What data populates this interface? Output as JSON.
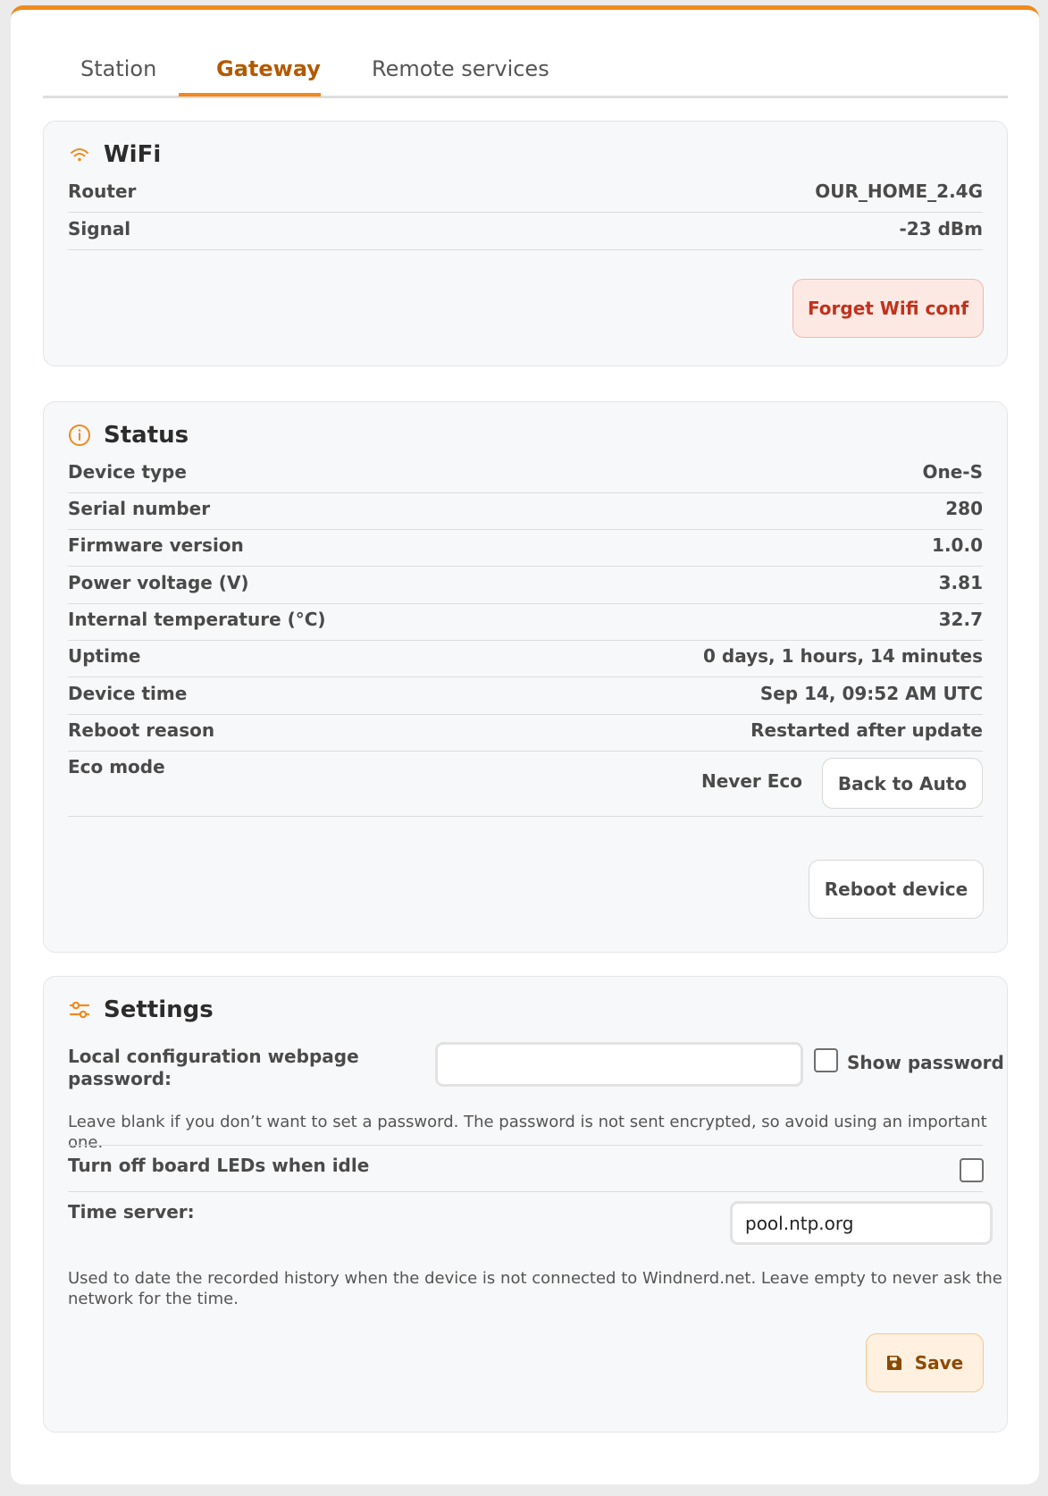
{
  "tabs": [
    {
      "label": "Station"
    },
    {
      "label": "Gateway"
    },
    {
      "label": "Remote services"
    }
  ],
  "active_tab": "Gateway",
  "accent_color": "#f08a1c",
  "wifi": {
    "title": "WiFi",
    "icon": "wifi-icon",
    "rows": [
      {
        "label": "Router",
        "value": "OUR_HOME_2.4G"
      },
      {
        "label": "Signal",
        "value": "-23 dBm"
      }
    ],
    "forget_button": "Forget Wifi conf"
  },
  "status": {
    "title": "Status",
    "icon": "info-icon",
    "rows": [
      {
        "label": "Device type",
        "value": "One-S"
      },
      {
        "label": "Serial number",
        "value": "280"
      },
      {
        "label": "Firmware version",
        "value": "1.0.0"
      },
      {
        "label": "Power voltage (V)",
        "value": "3.81"
      },
      {
        "label": "Internal temperature (°C)",
        "value": "32.7"
      },
      {
        "label": "Uptime",
        "value": "0 days, 1 hours, 14 minutes"
      },
      {
        "label": "Device time",
        "value": "Sep 14, 09:52 AM UTC"
      },
      {
        "label": "Reboot reason",
        "value": "Restarted after update"
      }
    ],
    "eco_mode": {
      "label": "Eco mode",
      "value": "Never Eco",
      "button": "Back to Auto"
    },
    "reboot_button": "Reboot device"
  },
  "settings": {
    "title": "Settings",
    "icon": "sliders-icon",
    "password": {
      "label_line1": "Local configuration webpage",
      "label_line2": "password:",
      "value": "",
      "show_password_label": "Show password",
      "show_password_checked": false,
      "help": "Leave blank if you don’t want to set a password. The password is not sent encrypted, so avoid using an important one."
    },
    "leds": {
      "label": "Turn off board LEDs when idle",
      "checked": false
    },
    "time_server": {
      "label": "Time server:",
      "value": "pool.ntp.org",
      "help_line1": "Used to date the recorded history when the device is not connected to Windnerd.net. Leave empty to never ask the",
      "help_line2": "network for the time."
    },
    "save_button": "Save",
    "save_icon": "floppy-disk-icon"
  }
}
